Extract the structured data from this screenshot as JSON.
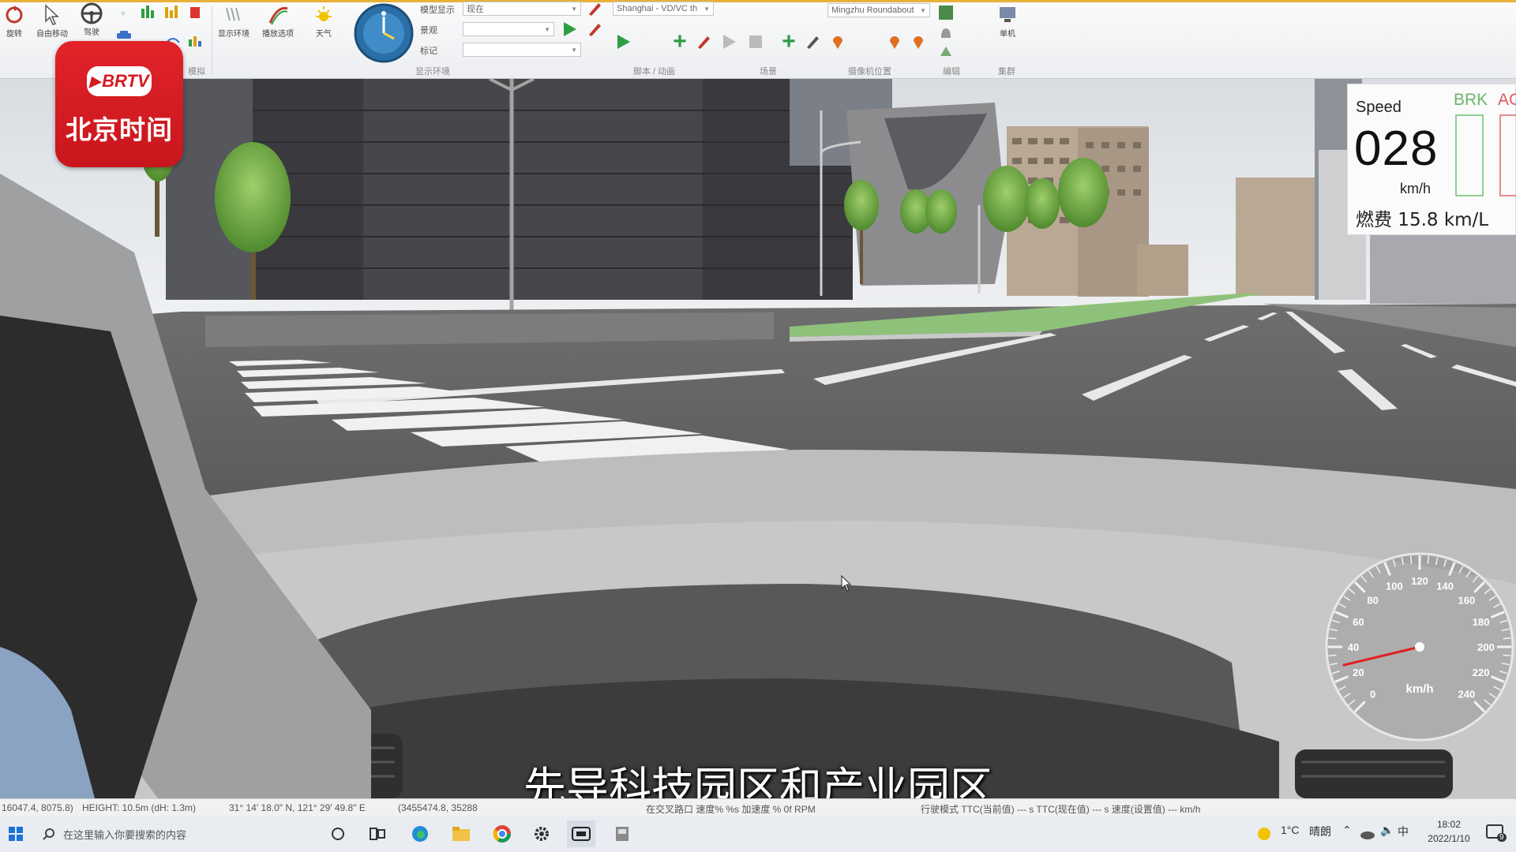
{
  "ribbon": {
    "buttons": [
      {
        "label": "旋转"
      },
      {
        "label": "自由移动"
      },
      {
        "label": "驾驶"
      },
      {
        "label": "显示环境"
      },
      {
        "label": "播放选项"
      },
      {
        "label": "天气"
      },
      {
        "label": "单机"
      }
    ],
    "groups": [
      "模拟",
      "显示环境",
      "脚本 / 动画",
      "场景",
      "摄像机位置",
      "编辑",
      "集群"
    ],
    "fields": {
      "model_display_label": "模型显示",
      "model_display_value": "现在",
      "scene_label": "景观",
      "marker_label": "标记",
      "map_select": "Shanghai - VD/VC th",
      "location_select": "Mingzhu Roundabout"
    }
  },
  "logo": {
    "brand": "BRTV",
    "name": "北京时间"
  },
  "hud": {
    "speed_label": "Speed",
    "speed_value": "028",
    "speed_unit": "km/h",
    "fuel": "燃费 15.8 km/L",
    "brk": "BRK",
    "acc": "AC"
  },
  "gauge": {
    "ticks": [
      "0",
      "20",
      "40",
      "60",
      "80",
      "100",
      "120",
      "140",
      "160",
      "180",
      "200",
      "220",
      "240"
    ],
    "unit": "km/h",
    "value": 28,
    "max": 240
  },
  "caption": "先导科技园区和产业园区",
  "status": {
    "coords": "16047.4, 8075.8)",
    "height": "HEIGHT: 10.5m (dH: 1.3m)",
    "latlon": "31° 14' 18.0\" N, 121° 29' 49.8\" E",
    "grid": "(3455474.8, 35288",
    "metrics": "在交叉路口 速度% %s  加速度 %  0f RPM",
    "ttc": "行驶模式  TTC(当前值) --- s   TTC(现在值) --- s   速度(设置值) --- km/h"
  },
  "taskbar": {
    "search_placeholder": "在这里输入你要搜索的内容",
    "temperature": "1°C",
    "weather": "晴朗",
    "ime": "中",
    "time": "18:02",
    "date": "2022/1/10",
    "notification_count": "9"
  }
}
